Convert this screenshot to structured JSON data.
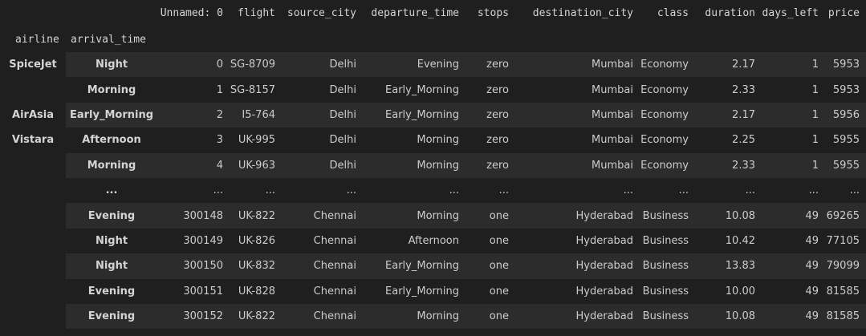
{
  "columns": [
    "Unnamed: 0",
    "flight",
    "source_city",
    "departure_time",
    "stops",
    "destination_city",
    "class",
    "duration",
    "days_left",
    "price"
  ],
  "index_names": [
    "airline",
    "arrival_time"
  ],
  "rows": [
    {
      "airline": "SpiceJet",
      "arrival_time": "Night",
      "cells": [
        "0",
        "SG-8709",
        "Delhi",
        "Evening",
        "zero",
        "Mumbai",
        "Economy",
        "2.17",
        "1",
        "5953"
      ]
    },
    {
      "airline": "",
      "arrival_time": "Morning",
      "cells": [
        "1",
        "SG-8157",
        "Delhi",
        "Early_Morning",
        "zero",
        "Mumbai",
        "Economy",
        "2.33",
        "1",
        "5953"
      ]
    },
    {
      "airline": "AirAsia",
      "arrival_time": "Early_Morning",
      "cells": [
        "2",
        "I5-764",
        "Delhi",
        "Early_Morning",
        "zero",
        "Mumbai",
        "Economy",
        "2.17",
        "1",
        "5956"
      ]
    },
    {
      "airline": "Vistara",
      "arrival_time": "Afternoon",
      "cells": [
        "3",
        "UK-995",
        "Delhi",
        "Morning",
        "zero",
        "Mumbai",
        "Economy",
        "2.25",
        "1",
        "5955"
      ]
    },
    {
      "airline": "",
      "arrival_time": "Morning",
      "cells": [
        "4",
        "UK-963",
        "Delhi",
        "Morning",
        "zero",
        "Mumbai",
        "Economy",
        "2.33",
        "1",
        "5955"
      ]
    },
    {
      "airline": "",
      "arrival_time": "...",
      "cells": [
        "...",
        "...",
        "...",
        "...",
        "...",
        "...",
        "...",
        "...",
        "...",
        "..."
      ]
    },
    {
      "airline": "",
      "arrival_time": "Evening",
      "cells": [
        "300148",
        "UK-822",
        "Chennai",
        "Morning",
        "one",
        "Hyderabad",
        "Business",
        "10.08",
        "49",
        "69265"
      ]
    },
    {
      "airline": "",
      "arrival_time": "Night",
      "cells": [
        "300149",
        "UK-826",
        "Chennai",
        "Afternoon",
        "one",
        "Hyderabad",
        "Business",
        "10.42",
        "49",
        "77105"
      ]
    },
    {
      "airline": "",
      "arrival_time": "Night",
      "cells": [
        "300150",
        "UK-832",
        "Chennai",
        "Early_Morning",
        "one",
        "Hyderabad",
        "Business",
        "13.83",
        "49",
        "79099"
      ]
    },
    {
      "airline": "",
      "arrival_time": "Evening",
      "cells": [
        "300151",
        "UK-828",
        "Chennai",
        "Early_Morning",
        "one",
        "Hyderabad",
        "Business",
        "10.00",
        "49",
        "81585"
      ]
    },
    {
      "airline": "",
      "arrival_time": "Evening",
      "cells": [
        "300152",
        "UK-822",
        "Chennai",
        "Morning",
        "one",
        "Hyderabad",
        "Business",
        "10.08",
        "49",
        "81585"
      ]
    }
  ]
}
